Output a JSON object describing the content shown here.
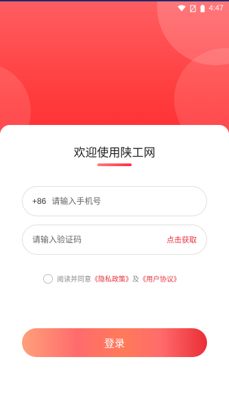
{
  "status_bar": {
    "time": "4:47",
    "icons": [
      "wifi-icon",
      "no-sim-icon",
      "battery-icon"
    ]
  },
  "login": {
    "title": "欢迎使用陕工网",
    "phone": {
      "prefix": "+86",
      "placeholder": "请输入手机号",
      "value": ""
    },
    "code": {
      "placeholder": "请输入验证码",
      "value": "",
      "get_code_label": "点击获取"
    },
    "agreement": {
      "checked": false,
      "text_prefix": "阅读并同意",
      "privacy_link": "《隐私政策》",
      "and_text": "及",
      "terms_link": "《用户协议》"
    },
    "submit_label": "登录"
  },
  "colors": {
    "accent": "#e8323c",
    "hero_top": "#ff5e62",
    "hero_bottom": "#ff2f36"
  }
}
